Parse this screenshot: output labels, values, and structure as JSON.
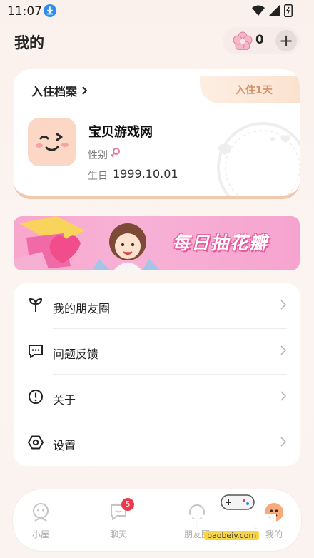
{
  "status_bar": {
    "time": "11:07"
  },
  "header": {
    "title": "我的",
    "petal_count": "0",
    "add_label": "+"
  },
  "profile": {
    "archive_label": "入住档案",
    "days_label": "入住1天",
    "nickname": "宝贝游戏网",
    "gender_label": "性别",
    "birthday_label": "生日",
    "birthday_value": "1999.10.01"
  },
  "banner": {
    "text": "每日抽花瓣"
  },
  "menu": {
    "items": [
      {
        "label": "我的朋友圈",
        "icon": "sprout-icon"
      },
      {
        "label": "问题反馈",
        "icon": "chat-bubble-icon"
      },
      {
        "label": "关于",
        "icon": "info-icon"
      },
      {
        "label": "设置",
        "icon": "hexagon-settings-icon"
      }
    ]
  },
  "tabbar": {
    "tabs": [
      {
        "label": "小屋",
        "icon": "home-face-icon"
      },
      {
        "label": "聊天",
        "icon": "chat-icon",
        "badge": "5"
      },
      {
        "label": "朋友圈",
        "icon": "moments-icon"
      },
      {
        "label": "我的",
        "icon": "profile-face-icon"
      }
    ]
  },
  "watermark": {
    "text": "宝贝游戏网",
    "url": "baobeiy.com"
  },
  "colors": {
    "accent": "#f9a97a",
    "badge": "#e93b4c",
    "banner_pink": "#f7b2d6"
  }
}
